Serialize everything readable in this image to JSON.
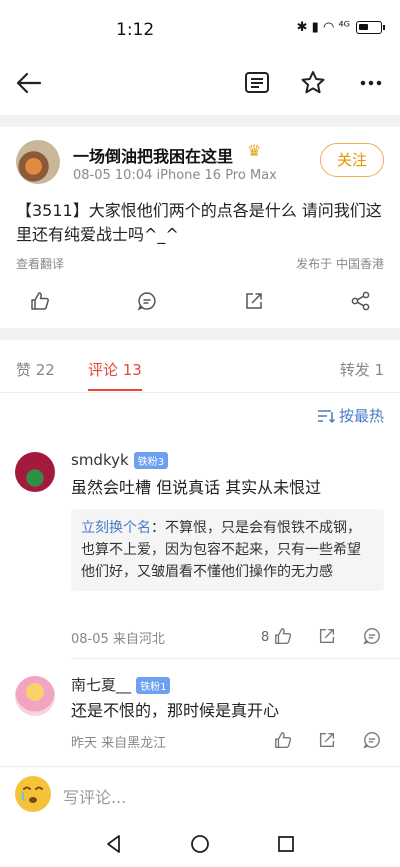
{
  "status": {
    "time": "1:12",
    "icons": "✱ ▮ ◠ ⁴ᴳ"
  },
  "post": {
    "author": "一场倒油把我困在这里",
    "meta": "08-05 10:04 iPhone 16 Pro Max",
    "follow_label": "关注",
    "text": "【3511】大家恨他们两个的点各是什么 请问我们这里还有纯爱战士吗^_^",
    "translate": "查看翻译",
    "posted_from": "发布于 中国香港"
  },
  "tabs": {
    "likes": "赞 22",
    "comments": "评论 13",
    "reposts": "转发 1"
  },
  "sort_label": "按最热",
  "comments": [
    {
      "name": "smdkyk",
      "badge": "铁粉3",
      "text": "虽然会吐槽 但说真话 其实从未恨过",
      "reply_user": "立刻换个名",
      "reply_text": "：不算恨，只是会有恨铁不成钢，也算不上爱，因为包容不起来，只有一些希望他们好，又皱眉看不懂他们操作的无力感",
      "meta": "08-05  来自河北",
      "likes": "8"
    },
    {
      "name": "南七夏__",
      "badge": "铁粉1",
      "text": "还是不恨的，那时候是真开心",
      "meta": "昨天  来自黑龙江",
      "likes": ""
    }
  ],
  "input_placeholder": "写评论..."
}
